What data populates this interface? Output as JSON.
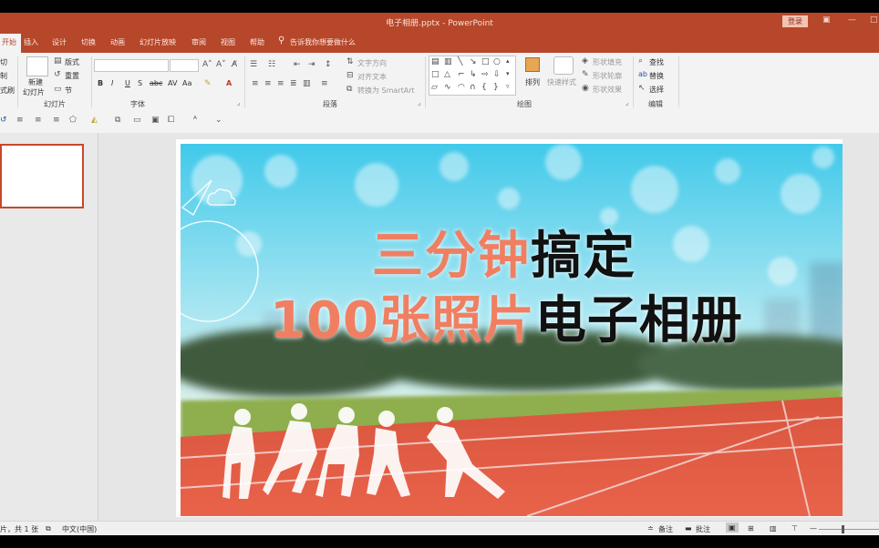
{
  "window": {
    "title": "电子相册.pptx  -  PowerPoint",
    "login_label": "登录"
  },
  "tabs": [
    {
      "label": "开始",
      "active": true
    },
    {
      "label": "插入"
    },
    {
      "label": "设计"
    },
    {
      "label": "切换"
    },
    {
      "label": "动画"
    },
    {
      "label": "幻灯片放映"
    },
    {
      "label": "审阅"
    },
    {
      "label": "视图"
    },
    {
      "label": "帮助"
    }
  ],
  "tell_me": "告诉我你想要做什么",
  "ribbon": {
    "slides_group": {
      "clip_cut": "切",
      "clip_copy": "制",
      "clip_format": "式刷",
      "new_slide_line1": "新建",
      "new_slide_line2": "幻灯片",
      "layout": "版式",
      "reset": "重置",
      "section": "节",
      "label": "幻灯片"
    },
    "font_group": {
      "label": "字体",
      "buttons": [
        "B",
        "I",
        "U",
        "S",
        "abc",
        "AV",
        "Aa",
        "A"
      ]
    },
    "paragraph_group": {
      "text_direction": "文字方向",
      "align_text": "对齐文本",
      "convert_smartart": "转换为 SmartArt",
      "label": "段落"
    },
    "drawing_group": {
      "arrange": "排列",
      "quick_styles": "快速样式",
      "shape_fill": "形状填充",
      "shape_outline": "形状轮廓",
      "shape_effects": "形状效果",
      "label": "绘图"
    },
    "editing_group": {
      "find": "查找",
      "replace": "替换",
      "select": "选择",
      "label": "编辑"
    }
  },
  "slide": {
    "line1_accent": "三分钟",
    "line1_dark": "搞定",
    "line2_accent": "100张照片",
    "line2_dark": "电子相册",
    "accent_color": "#f07f62",
    "dark_color": "#111111"
  },
  "statusbar": {
    "slide_info": "片，共 1 张",
    "language": "中文(中国)",
    "notes": "备注",
    "comments": "批注"
  },
  "colors": {
    "brand": "#b7472a",
    "ribbon_bg": "#f3f3f3",
    "workspace_bg": "#e6e6e6"
  }
}
